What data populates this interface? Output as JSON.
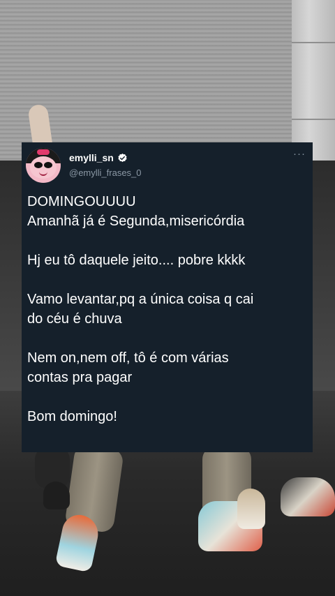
{
  "tweet": {
    "display_name": "emylli_sn",
    "handle": "@emylli_frases_0",
    "more_icon": "ellipsis-icon",
    "verified_icon": "verified-badge-icon",
    "verified_color": "#ffffff",
    "card_bg": "#15202b",
    "lines": {
      "p1_l1": "DOMINGOUUUU",
      "p1_l2": "Amanhã já é Segunda,misericórdia",
      "p2_l1": "Hj eu tô daquele jeito.... pobre kkkk",
      "p3_l1": "Vamo levantar,pq a única coisa q cai",
      "p3_l2": "do céu é chuva",
      "p4_l1": "Nem on,nem off, tô é com várias",
      "p4_l2": "contas pra pagar",
      "p5_l1": "Bom domingo!"
    }
  }
}
